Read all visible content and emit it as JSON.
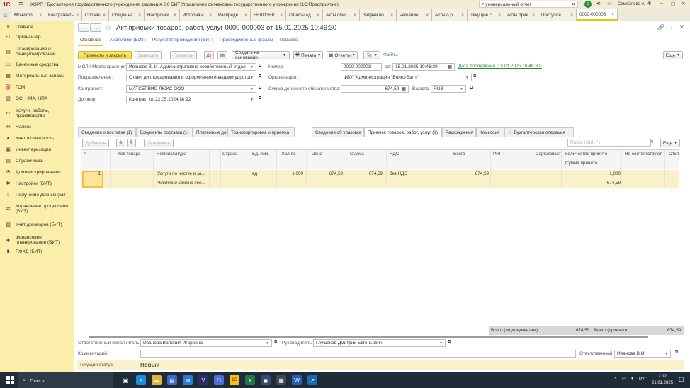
{
  "app": {
    "logo": "1С",
    "title": "КОРП / Бухгалтерия государственного учреждения, редакция 2.0 БИТ Управление финансами государственного учреждения  (1С:Предприятие)",
    "search_value": "универсальный отчет",
    "user": "Самойлова А. Н.",
    "notification_count": "1"
  },
  "tabs": [
    {
      "label": "Монитор ..."
    },
    {
      "label": "Контрагенты"
    },
    {
      "label": "Справка"
    },
    {
      "label": "Общие на..."
    },
    {
      "label": "Настройки..."
    },
    {
      "label": "История и..."
    },
    {
      "label": "Распреде..."
    },
    {
      "label": "БЕЛОЗЕР..."
    },
    {
      "label": "Отчеты ад..."
    },
    {
      "label": "Акты спис..."
    },
    {
      "label": "Задачи по..."
    },
    {
      "label": "Решение ..."
    },
    {
      "label": "Акты о р..."
    },
    {
      "label": "Текущие с..."
    },
    {
      "label": "Акты прие..."
    },
    {
      "label": "Поступле..."
    },
    {
      "label": "0000-000003"
    }
  ],
  "sidebar": [
    {
      "label": "Главное",
      "icon": "menu-icon"
    },
    {
      "label": "Органайзер",
      "icon": "people-icon"
    },
    {
      "label": "Планирование и санкционирование",
      "icon": "planning-icon"
    },
    {
      "label": "Денежные средства",
      "icon": "money-icon"
    },
    {
      "label": "Материальные запасы",
      "icon": "box-icon"
    },
    {
      "label": "ГСМ",
      "icon": "fuel-icon"
    },
    {
      "label": "ОС, НМА, НПА",
      "icon": "building-icon"
    },
    {
      "label": "Услуги, работы, производство",
      "icon": "tools-icon"
    },
    {
      "label": "Налоги",
      "icon": "tax-icon"
    },
    {
      "label": "Учет и отчетность",
      "icon": "report-icon"
    },
    {
      "label": "Инвентаризация",
      "icon": "inventory-icon"
    },
    {
      "label": "Справочники",
      "icon": "book-icon"
    },
    {
      "label": "Администрирование",
      "icon": "gear-icon"
    },
    {
      "label": "Настройки (БИТ)",
      "icon": "wrench-icon"
    },
    {
      "label": "Получение данных (БИТ)",
      "icon": "download-icon"
    },
    {
      "label": "Управление процессами (БИТ)",
      "icon": "process-icon"
    },
    {
      "label": "Учет договоров (БИТ)",
      "icon": "contract-icon"
    },
    {
      "label": "Финансовое планирование (БИТ)",
      "icon": "finance-icon"
    },
    {
      "label": "ПФХД (БИТ)",
      "icon": "chart-icon"
    }
  ],
  "doc": {
    "title": "Акт приемки товаров, работ, услуг 0000-000003 от 15.01.2025 10:46:30",
    "subnav": [
      "Основное",
      "Аналитики (БИТ)",
      "Результат проведения (БИТ)",
      "Присоединенные файлы",
      "Процесс"
    ],
    "toolbar": {
      "post_close": "Провести и закрыть",
      "save": "Записать",
      "post": "Провести",
      "create_based": "Создать на основании",
      "print": "Печать",
      "reports": "Отчеты",
      "files": "Файлы",
      "more": "Еще"
    },
    "fields": {
      "mol_label": "МОЛ / Место хранения:",
      "mol_value": "Иванова В. И.  Административно-хозяйственный отдел",
      "number_label": "Номер:",
      "number_value": "0000-000003",
      "date_label": "от:",
      "date_value": "15.01.2025 10:46:30",
      "posting_date_link": "Дата проведения (15.01.2025 10:46:30)",
      "dept_label": "Подразделение:",
      "dept_value": "Отдел диплома­рования и оформления и выдачи удостове",
      "org_label": "Организация:",
      "org_value": "ФБУ \"Администрация \"Волго-Балт\"",
      "counterparty_label": "Контрагент:",
      "counterparty_value": "МАТСЕРВИС ЛЮКС ООО",
      "amount_label": "Сумма денежного обязательства:",
      "amount_value": "674,59",
      "currency_label": "Валюта:",
      "currency_value": "RUB",
      "contract_label": "Договор:",
      "contract_value": "Контракт от 22.05.2024 № 22"
    },
    "doc_tabs": [
      "Сведения о поставке (1)",
      "Документы поставки (1)",
      "Платежные документы",
      "Транспортировка и приемка",
      "Сведения об упаковке",
      "Приемка товаров, работ, услуг (1)",
      "Расхождения",
      "Комиссия",
      "Бухгалтерская операция"
    ],
    "table_toolbar": {
      "add": "Добавить",
      "fill": "Заполнить",
      "search_placeholder": "Поиск (Ctrl+F)",
      "more": "Еще"
    },
    "columns": [
      "N",
      "Код товара",
      "Номенклатура",
      "Страна",
      "Ед. изм.",
      "Кол-во",
      "Цена",
      "Сумма",
      "НДС",
      "Всего",
      "РНПТ",
      "Сертификат",
      "Количество принято",
      "Не соответствуют",
      "Откл"
    ],
    "column_sub": "Сумма принято",
    "rows": [
      {
        "n": "1",
        "code": "",
        "nomenclature": "Услуги по чистке и за...",
        "nomenclature2": "Чистка и замена кое...",
        "country": "",
        "unit": "ед",
        "qty": "1,000",
        "price": "674,59",
        "sum": "674,59",
        "vat": "без НДС",
        "total": "674,59",
        "qty_accepted": "1,000",
        "sum_accepted": "674,59"
      }
    ],
    "totals": {
      "doc_label": "Всего (по документам):",
      "doc_value": "674,59",
      "accepted_label": "Всего (принято):",
      "accepted_value": "674,59"
    },
    "footer": {
      "executor_label": "Ответственный исполнитель:",
      "executor_value": "Иванова Валерия Игоревна",
      "head_label": "Руководитель:",
      "head_value": "Глушаков Дмитрий Евгеньевич",
      "comment_label": "Комментарий:",
      "comment_value": "",
      "responsible_label": "Ответственный:",
      "responsible_value": "Иванова В.И.",
      "status_label": "Текущий статус:",
      "status_value": "Новый"
    }
  },
  "taskbar": {
    "search_label": "Поиск",
    "lang": "РУС",
    "time": "12:12",
    "date": "21.01.2025"
  }
}
